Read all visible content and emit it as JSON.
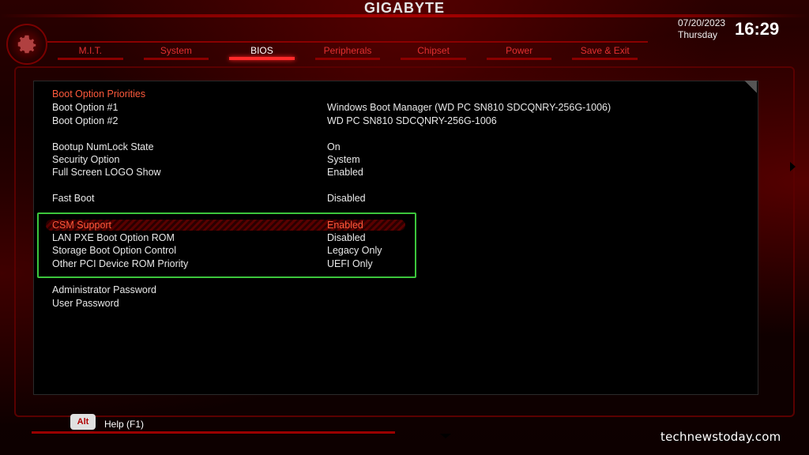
{
  "header": {
    "brand": "GIGABYTE",
    "date": "07/20/2023",
    "day": "Thursday",
    "time": "16:29"
  },
  "tabs": [
    {
      "label": "M.I.T."
    },
    {
      "label": "System"
    },
    {
      "label": "BIOS",
      "active": true
    },
    {
      "label": "Peripherals"
    },
    {
      "label": "Chipset"
    },
    {
      "label": "Power"
    },
    {
      "label": "Save & Exit"
    }
  ],
  "settings": {
    "section_title": "Boot Option Priorities",
    "rows": [
      {
        "label": "Boot Option #1",
        "value": "Windows Boot Manager (WD PC SN810 SDCQNRY-256G-1006)"
      },
      {
        "label": "Boot Option #2",
        "value": "WD PC SN810 SDCQNRY-256G-1006"
      },
      {
        "label": "Bootup NumLock State",
        "value": "On"
      },
      {
        "label": "Security Option",
        "value": "System"
      },
      {
        "label": "Full Screen LOGO Show",
        "value": "Enabled"
      },
      {
        "label": "Fast Boot",
        "value": "Disabled"
      },
      {
        "label": "CSM Support",
        "value": "Enabled",
        "selected": true
      },
      {
        "label": "LAN PXE Boot Option ROM",
        "value": "Disabled"
      },
      {
        "label": "Storage Boot Option Control",
        "value": "Legacy Only"
      },
      {
        "label": "Other PCI Device ROM Priority",
        "value": "UEFI Only"
      },
      {
        "label": "Administrator Password",
        "value": ""
      },
      {
        "label": "User Password",
        "value": ""
      }
    ]
  },
  "footer": {
    "alt_key": "Alt",
    "help": "Help (F1)"
  },
  "watermark": "technewstoday.com",
  "colors": {
    "accent_red": "#ff5a3c",
    "tab_red": "#e23030",
    "highlight_box": "#3cc63c"
  }
}
